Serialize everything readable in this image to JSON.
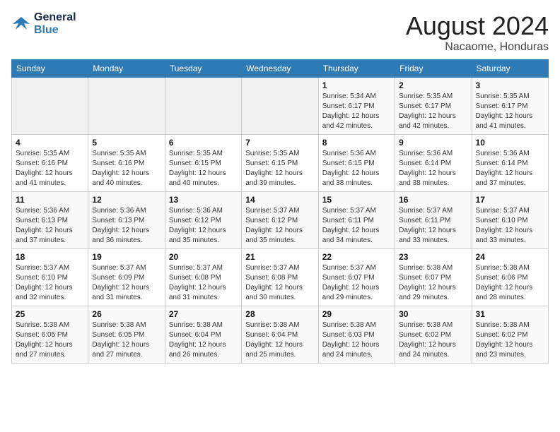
{
  "logo": {
    "line1": "General",
    "line2": "Blue"
  },
  "title": {
    "month_year": "August 2024",
    "location": "Nacaome, Honduras"
  },
  "days_of_week": [
    "Sunday",
    "Monday",
    "Tuesday",
    "Wednesday",
    "Thursday",
    "Friday",
    "Saturday"
  ],
  "weeks": [
    [
      {
        "day": "",
        "info": ""
      },
      {
        "day": "",
        "info": ""
      },
      {
        "day": "",
        "info": ""
      },
      {
        "day": "",
        "info": ""
      },
      {
        "day": "1",
        "info": "Sunrise: 5:34 AM\nSunset: 6:17 PM\nDaylight: 12 hours\nand 42 minutes."
      },
      {
        "day": "2",
        "info": "Sunrise: 5:35 AM\nSunset: 6:17 PM\nDaylight: 12 hours\nand 42 minutes."
      },
      {
        "day": "3",
        "info": "Sunrise: 5:35 AM\nSunset: 6:17 PM\nDaylight: 12 hours\nand 41 minutes."
      }
    ],
    [
      {
        "day": "4",
        "info": "Sunrise: 5:35 AM\nSunset: 6:16 PM\nDaylight: 12 hours\nand 41 minutes."
      },
      {
        "day": "5",
        "info": "Sunrise: 5:35 AM\nSunset: 6:16 PM\nDaylight: 12 hours\nand 40 minutes."
      },
      {
        "day": "6",
        "info": "Sunrise: 5:35 AM\nSunset: 6:15 PM\nDaylight: 12 hours\nand 40 minutes."
      },
      {
        "day": "7",
        "info": "Sunrise: 5:35 AM\nSunset: 6:15 PM\nDaylight: 12 hours\nand 39 minutes."
      },
      {
        "day": "8",
        "info": "Sunrise: 5:36 AM\nSunset: 6:15 PM\nDaylight: 12 hours\nand 38 minutes."
      },
      {
        "day": "9",
        "info": "Sunrise: 5:36 AM\nSunset: 6:14 PM\nDaylight: 12 hours\nand 38 minutes."
      },
      {
        "day": "10",
        "info": "Sunrise: 5:36 AM\nSunset: 6:14 PM\nDaylight: 12 hours\nand 37 minutes."
      }
    ],
    [
      {
        "day": "11",
        "info": "Sunrise: 5:36 AM\nSunset: 6:13 PM\nDaylight: 12 hours\nand 37 minutes."
      },
      {
        "day": "12",
        "info": "Sunrise: 5:36 AM\nSunset: 6:13 PM\nDaylight: 12 hours\nand 36 minutes."
      },
      {
        "day": "13",
        "info": "Sunrise: 5:36 AM\nSunset: 6:12 PM\nDaylight: 12 hours\nand 35 minutes."
      },
      {
        "day": "14",
        "info": "Sunrise: 5:37 AM\nSunset: 6:12 PM\nDaylight: 12 hours\nand 35 minutes."
      },
      {
        "day": "15",
        "info": "Sunrise: 5:37 AM\nSunset: 6:11 PM\nDaylight: 12 hours\nand 34 minutes."
      },
      {
        "day": "16",
        "info": "Sunrise: 5:37 AM\nSunset: 6:11 PM\nDaylight: 12 hours\nand 33 minutes."
      },
      {
        "day": "17",
        "info": "Sunrise: 5:37 AM\nSunset: 6:10 PM\nDaylight: 12 hours\nand 33 minutes."
      }
    ],
    [
      {
        "day": "18",
        "info": "Sunrise: 5:37 AM\nSunset: 6:10 PM\nDaylight: 12 hours\nand 32 minutes."
      },
      {
        "day": "19",
        "info": "Sunrise: 5:37 AM\nSunset: 6:09 PM\nDaylight: 12 hours\nand 31 minutes."
      },
      {
        "day": "20",
        "info": "Sunrise: 5:37 AM\nSunset: 6:08 PM\nDaylight: 12 hours\nand 31 minutes."
      },
      {
        "day": "21",
        "info": "Sunrise: 5:37 AM\nSunset: 6:08 PM\nDaylight: 12 hours\nand 30 minutes."
      },
      {
        "day": "22",
        "info": "Sunrise: 5:37 AM\nSunset: 6:07 PM\nDaylight: 12 hours\nand 29 minutes."
      },
      {
        "day": "23",
        "info": "Sunrise: 5:38 AM\nSunset: 6:07 PM\nDaylight: 12 hours\nand 29 minutes."
      },
      {
        "day": "24",
        "info": "Sunrise: 5:38 AM\nSunset: 6:06 PM\nDaylight: 12 hours\nand 28 minutes."
      }
    ],
    [
      {
        "day": "25",
        "info": "Sunrise: 5:38 AM\nSunset: 6:05 PM\nDaylight: 12 hours\nand 27 minutes."
      },
      {
        "day": "26",
        "info": "Sunrise: 5:38 AM\nSunset: 6:05 PM\nDaylight: 12 hours\nand 27 minutes."
      },
      {
        "day": "27",
        "info": "Sunrise: 5:38 AM\nSunset: 6:04 PM\nDaylight: 12 hours\nand 26 minutes."
      },
      {
        "day": "28",
        "info": "Sunrise: 5:38 AM\nSunset: 6:04 PM\nDaylight: 12 hours\nand 25 minutes."
      },
      {
        "day": "29",
        "info": "Sunrise: 5:38 AM\nSunset: 6:03 PM\nDaylight: 12 hours\nand 24 minutes."
      },
      {
        "day": "30",
        "info": "Sunrise: 5:38 AM\nSunset: 6:02 PM\nDaylight: 12 hours\nand 24 minutes."
      },
      {
        "day": "31",
        "info": "Sunrise: 5:38 AM\nSunset: 6:02 PM\nDaylight: 12 hours\nand 23 minutes."
      }
    ]
  ]
}
